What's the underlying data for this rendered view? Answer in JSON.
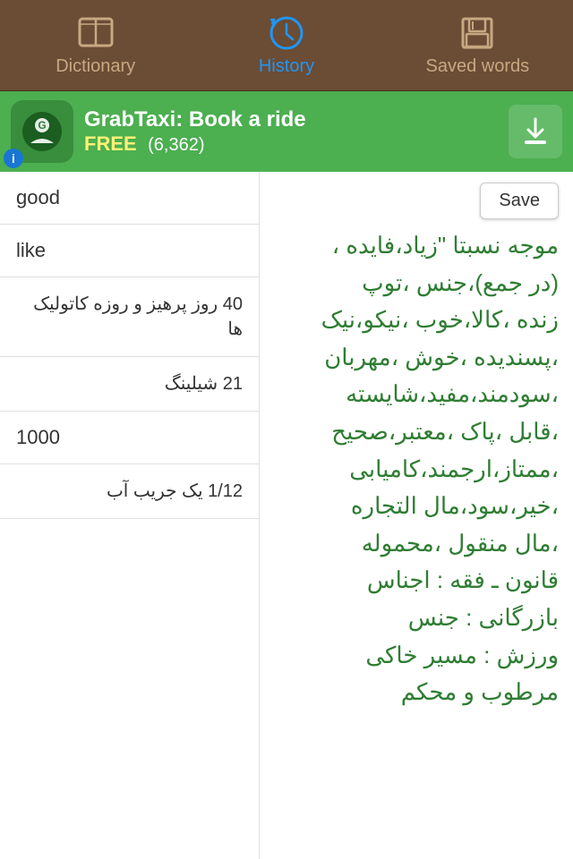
{
  "tabs": [
    {
      "id": "dictionary",
      "label": "Dictionary",
      "active": false
    },
    {
      "id": "history",
      "label": "History",
      "active": true
    },
    {
      "id": "saved",
      "label": "Saved words",
      "active": false
    }
  ],
  "ad": {
    "title": "GrabTaxi: Book a ride",
    "free_label": "FREE",
    "count": "(6,362)",
    "download_label": "Download",
    "info_label": "i"
  },
  "toolbar": {
    "save_label": "Save"
  },
  "history_items": [
    {
      "id": 1,
      "text": "good",
      "rtl": false
    },
    {
      "id": 2,
      "text": "like",
      "rtl": false
    },
    {
      "id": 3,
      "text": "40 روز پرهیز و روزه کاتولیک ها",
      "rtl": true
    },
    {
      "id": 4,
      "text": "21 شیلینگ",
      "rtl": true
    },
    {
      "id": 5,
      "text": "1000",
      "rtl": false
    },
    {
      "id": 6,
      "text": "1/12 یک جریب آب",
      "rtl": true
    }
  ],
  "definition": "موجه نسبتا \"زیاد،فایده ،\n(در جمع)،جنس ،توپ\nزنده ،کالا،خوب ،نیکو،نیک\n،پسندیده ،خوش ،مهربان\n،سودمند،مفید،شایسته\n،قابل ،پاک ،معتبر،صحیح\n،ممتاز،ارجمند،کامیابی\n،خیر،سود،مال التجاره\n،مال منقول ،محموله\nقانون ـ فقه : اجناس\nبازرگانی : جنس\nورزش : مسیر خاکی\nمرطوب و محکم"
}
